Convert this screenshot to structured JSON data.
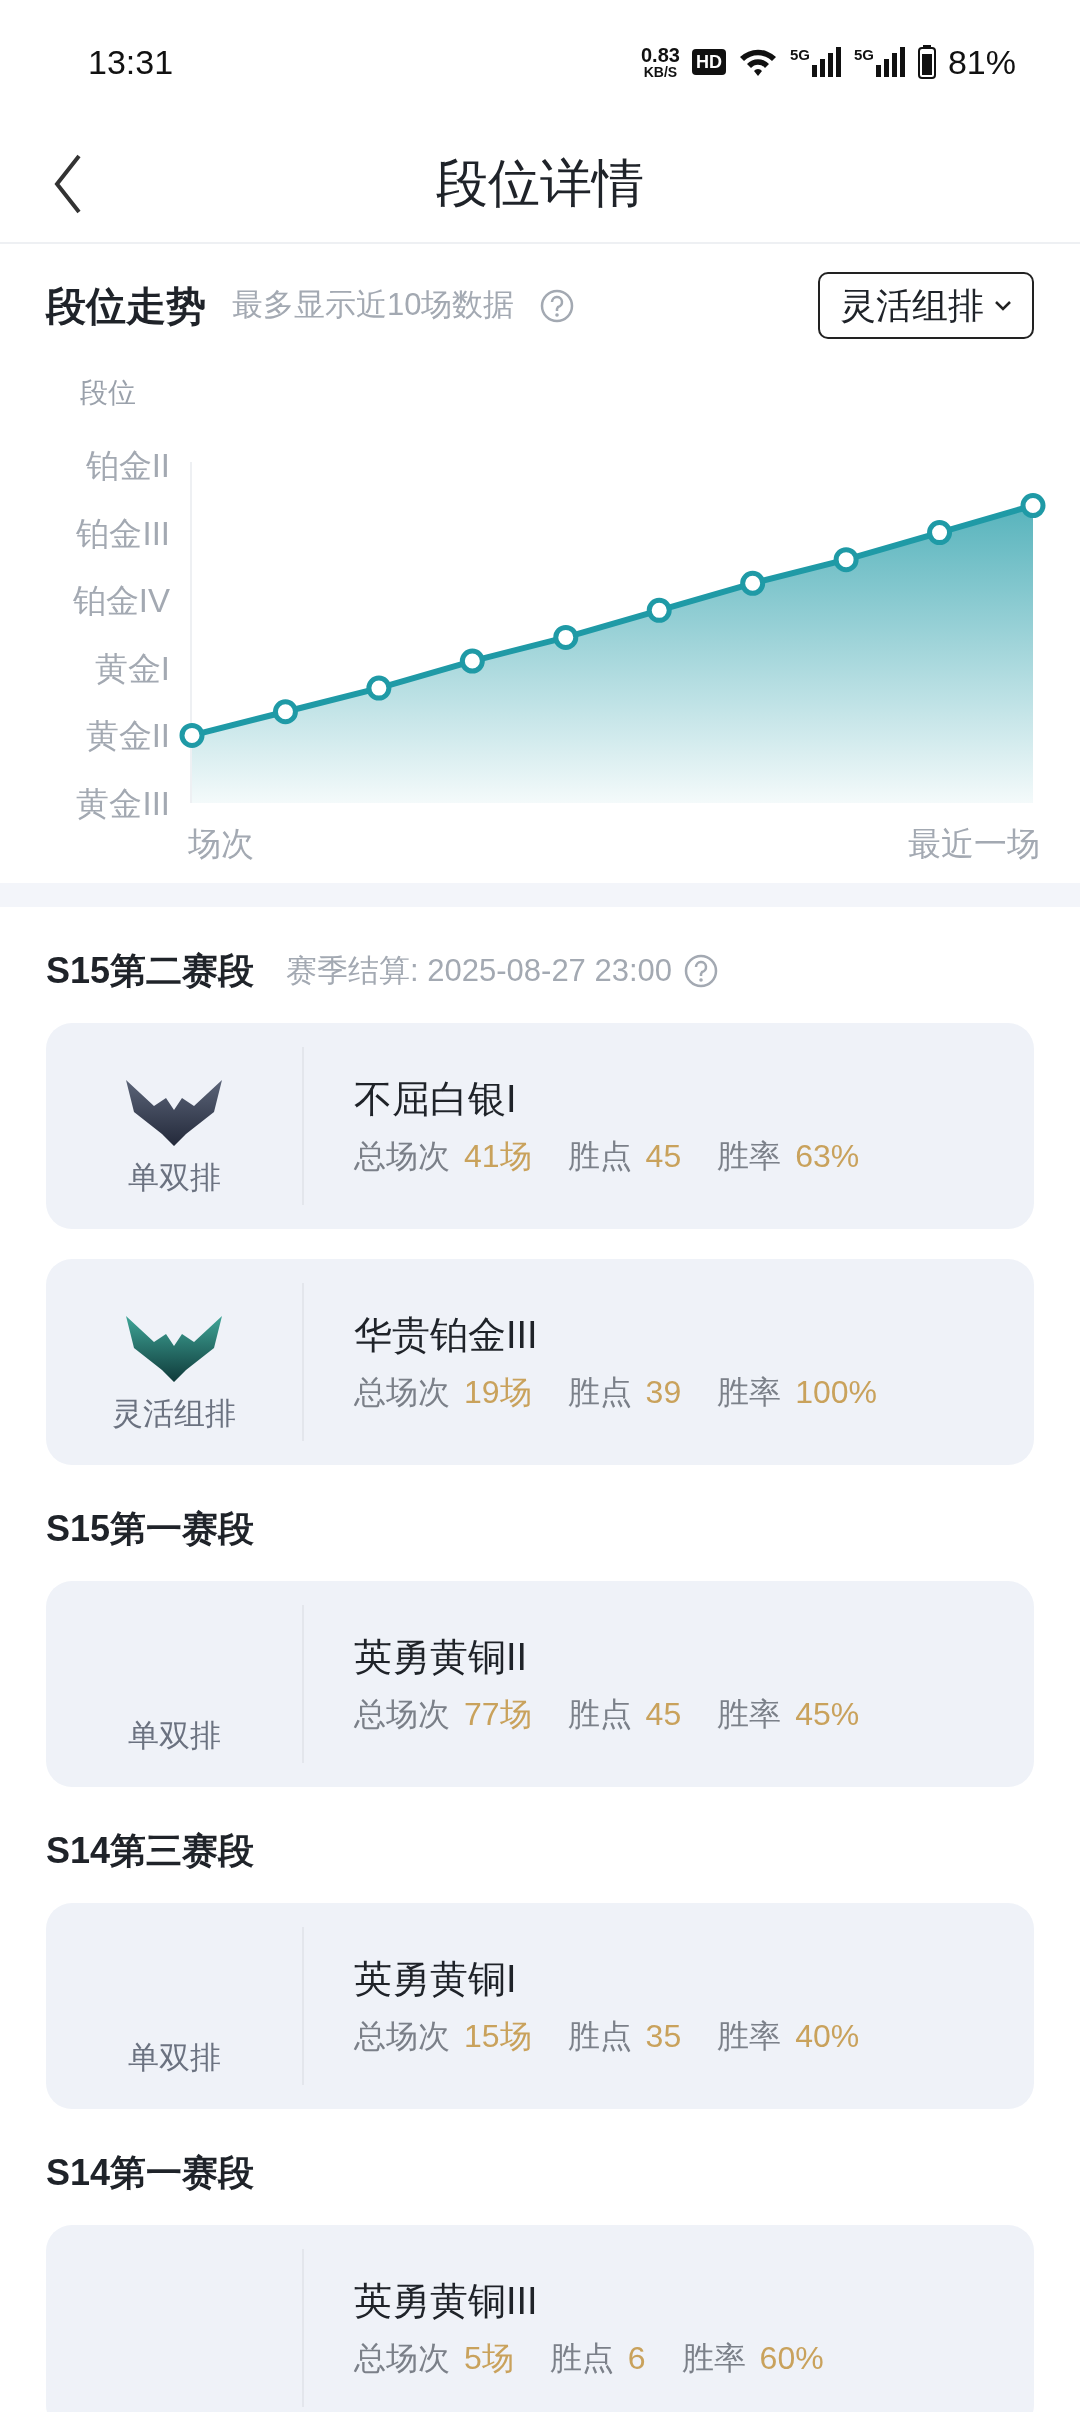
{
  "status_bar": {
    "time": "13:31",
    "net_speed": "0.83",
    "net_unit": "KB/S",
    "hd": "HD",
    "signal_1": "5G",
    "signal_2": "5G",
    "battery": "81%"
  },
  "header": {
    "title": "段位详情"
  },
  "trend": {
    "title": "段位走势",
    "subtitle": "最多显示近10场数据",
    "filter": "灵活组排",
    "axis_title": "段位",
    "rank_axis": [
      "铂金II",
      "铂金III",
      "铂金IV",
      "黄金I",
      "黄金II",
      "黄金III"
    ],
    "x_caption_start": "场次",
    "x_caption_end": "最近一场"
  },
  "seasons": [
    {
      "title": "S15第二赛段",
      "settle": "赛季结算: 2025-08-27 23:00",
      "records": [
        {
          "kind": "silver",
          "mode": "单双排",
          "rank": "不屈白银I",
          "stats": [
            {
              "label": "总场次",
              "value": "41场"
            },
            {
              "label": "胜点",
              "value": "45"
            },
            {
              "label": "胜率",
              "value": "63%"
            }
          ]
        },
        {
          "kind": "platinum",
          "mode": "灵活组排",
          "rank": "华贵铂金III",
          "stats": [
            {
              "label": "总场次",
              "value": "19场"
            },
            {
              "label": "胜点",
              "value": "39"
            },
            {
              "label": "胜率",
              "value": "100%"
            }
          ]
        }
      ]
    },
    {
      "title": "S15第一赛段",
      "records": [
        {
          "kind": "blank",
          "mode": "单双排",
          "rank": "英勇黄铜II",
          "stats": [
            {
              "label": "总场次",
              "value": "77场"
            },
            {
              "label": "胜点",
              "value": "45"
            },
            {
              "label": "胜率",
              "value": "45%"
            }
          ]
        }
      ]
    },
    {
      "title": "S14第三赛段",
      "records": [
        {
          "kind": "blank",
          "mode": "单双排",
          "rank": "英勇黄铜I",
          "stats": [
            {
              "label": "总场次",
              "value": "15场"
            },
            {
              "label": "胜点",
              "value": "35"
            },
            {
              "label": "胜率",
              "value": "40%"
            }
          ]
        }
      ]
    },
    {
      "title": "S14第一赛段",
      "records": [
        {
          "kind": "blank",
          "rank": "英勇黄铜III",
          "stats": [
            {
              "label": "总场次",
              "value": "5场"
            },
            {
              "label": "胜点",
              "value": "6"
            },
            {
              "label": "胜率",
              "value": "60%"
            }
          ]
        }
      ]
    }
  ]
}
